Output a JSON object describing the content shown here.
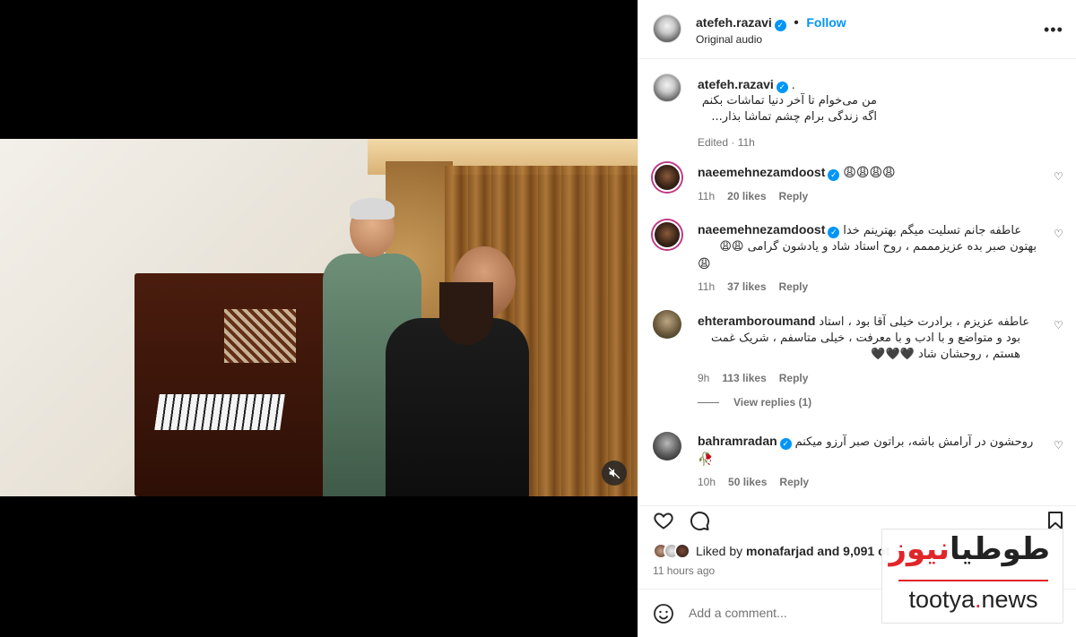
{
  "post": {
    "author": "atefeh.razavi",
    "follow_label": "Follow",
    "audio": "Original audio",
    "more_label": "•••"
  },
  "caption": {
    "username": "atefeh.razavi",
    "suffix": ".",
    "line1": "من می‌خوام تا آخر دنیا تماشات بکنم",
    "line2": "اگه زندگی برام چشم تماشا بذار...",
    "edited": "Edited · 11h"
  },
  "comments": [
    {
      "username": "naeemehnezamdoost",
      "text": "😩😩😩😩",
      "time": "11h",
      "likes": "20 likes",
      "reply": "Reply"
    },
    {
      "username": "naeemehnezamdoost",
      "text1": "عاطفه جانم تسلیت میگم بهترینم خدا",
      "text2": "بهتون صبر بده عزیزمممم ، روح استاد شاد و یادشون گرامی 😩😩",
      "text3": "😩",
      "time": "11h",
      "likes": "37 likes",
      "reply": "Reply"
    },
    {
      "username": "ehteramboroumand",
      "text1": "عاطفه عزیزم ، برادرت خیلی آقا بود ، استاد",
      "text2": "بود و متواضع و با ادب و با معرفت ، خیلی متاسفم ، شریک غمت",
      "text3": "هستم ، روحشان شاد 🖤🖤🖤",
      "time": "9h",
      "likes": "113 likes",
      "reply": "Reply",
      "view_replies": "View replies (1)"
    },
    {
      "username": "bahramradan",
      "text1": "روحشون در آرامش باشه، براتون صبر آرزو میکنم",
      "text2": "🥀",
      "time": "10h",
      "likes": "50 likes",
      "reply": "Reply"
    }
  ],
  "likes": {
    "prefix": "Liked by",
    "user": "monafarjad",
    "rest": "and 9,091 ot"
  },
  "time_ago": "11 hours ago",
  "comment_box": {
    "placeholder": "Add a comment..."
  },
  "watermark": {
    "logo_black": "طوطیا",
    "logo_red": "نیوز",
    "url_main": "tootya",
    "url_dot": ".",
    "url_tld": "news"
  },
  "colors": {
    "accent": "#0095f6",
    "watermark_red": "#e0262a"
  }
}
